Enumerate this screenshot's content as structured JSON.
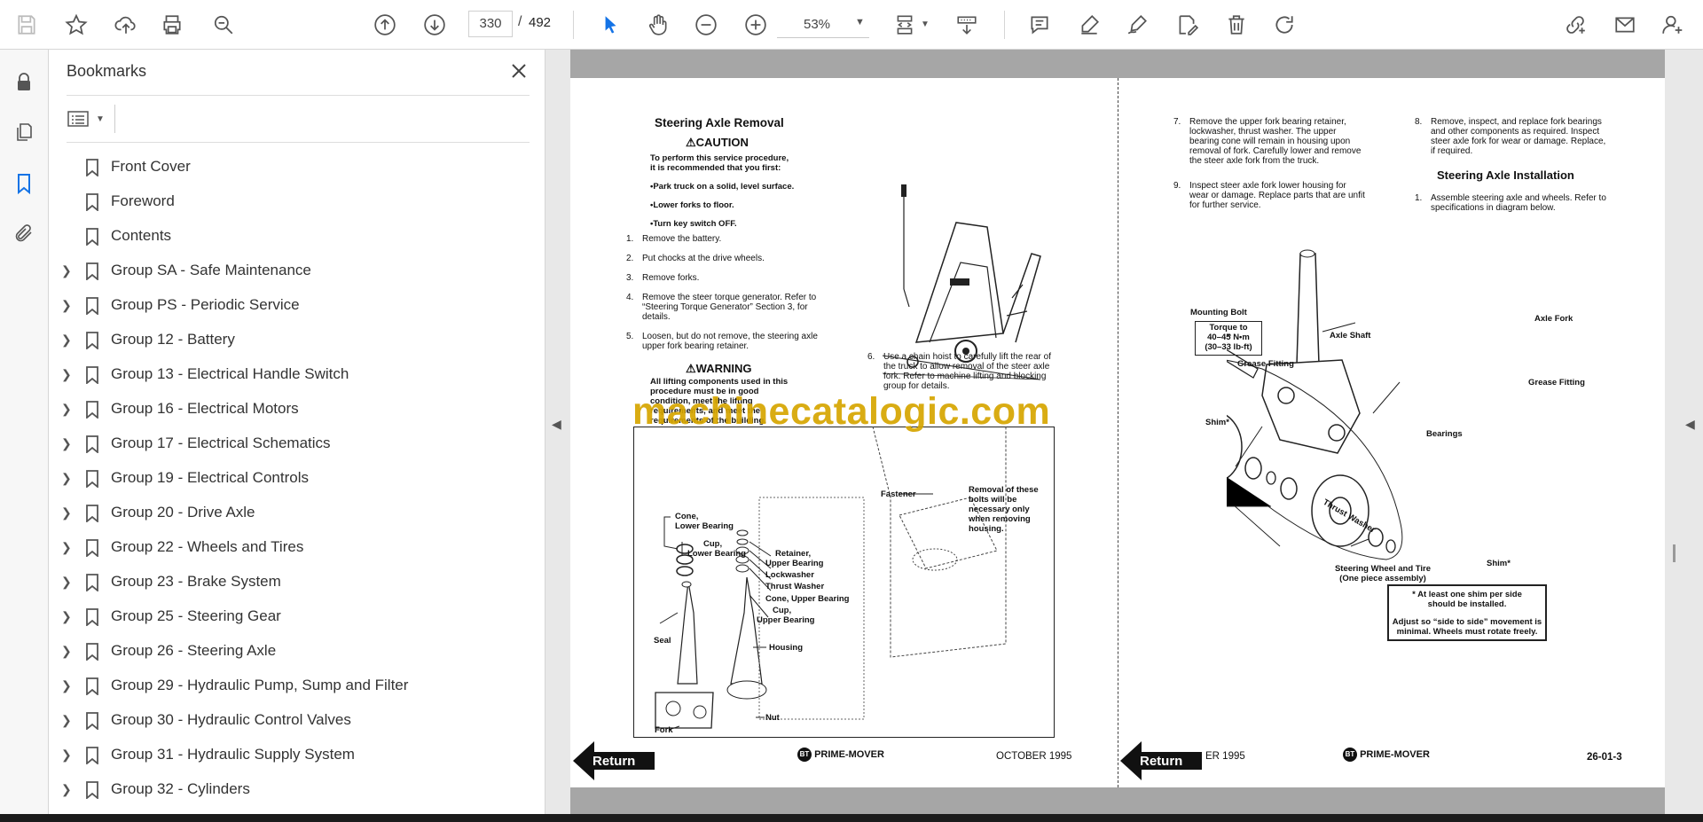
{
  "toolbar": {
    "current_page": "330",
    "page_separator": "/",
    "total_pages": "492",
    "zoom": "53%",
    "icons": [
      "save-icon",
      "bookmark-star-icon",
      "upload-icon",
      "print-icon",
      "zoom-search-icon",
      "prev-page-icon",
      "next-page-icon",
      "select-cursor-icon",
      "hand-icon",
      "zoom-out-icon",
      "zoom-in-icon",
      "fit-page-icon",
      "scroll-mode-icon",
      "comment-icon",
      "highlight-icon",
      "sign-icon",
      "edit-pdf-icon",
      "delete-icon",
      "rotate-icon",
      "share-link-icon",
      "email-icon",
      "add-user-icon"
    ]
  },
  "bookmarks_panel": {
    "title": "Bookmarks",
    "items": [
      {
        "label": "Front Cover",
        "expandable": false
      },
      {
        "label": "Foreword",
        "expandable": false
      },
      {
        "label": "Contents",
        "expandable": false
      },
      {
        "label": "Group SA - Safe Maintenance",
        "expandable": true
      },
      {
        "label": "Group PS - Periodic Service",
        "expandable": true
      },
      {
        "label": "Group 12 - Battery",
        "expandable": true
      },
      {
        "label": "Group 13 - Electrical Handle Switch",
        "expandable": true
      },
      {
        "label": "Group 16 - Electrical Motors",
        "expandable": true
      },
      {
        "label": "Group 17 - Electrical Schematics",
        "expandable": true
      },
      {
        "label": "Group 19 - Electrical Controls",
        "expandable": true
      },
      {
        "label": "Group 20 - Drive Axle",
        "expandable": true
      },
      {
        "label": "Group 22 - Wheels and Tires",
        "expandable": true
      },
      {
        "label": "Group 23 - Brake System",
        "expandable": true
      },
      {
        "label": "Group 25 - Steering Gear",
        "expandable": true
      },
      {
        "label": "Group 26 - Steering Axle",
        "expandable": true
      },
      {
        "label": "Group 29 - Hydraulic Pump, Sump and Filter",
        "expandable": true
      },
      {
        "label": "Group 30 - Hydraulic Control Valves",
        "expandable": true
      },
      {
        "label": "Group 31 - Hydraulic Supply System",
        "expandable": true
      },
      {
        "label": "Group 32 - Cylinders",
        "expandable": true
      }
    ]
  },
  "document": {
    "left_page": {
      "heading": "Steering Axle Removal",
      "caution_title": "CAUTION",
      "caution_intro_1": "To perform this service procedure,",
      "caution_intro_2": "it is recommended that you first:",
      "bullets": [
        "•Park truck on a solid, level surface.",
        "•Lower forks to floor.",
        "•Turn key switch OFF."
      ],
      "steps": [
        {
          "num": "1.",
          "lines": [
            "Remove the battery."
          ]
        },
        {
          "num": "2.",
          "lines": [
            "Put chocks at the drive wheels."
          ]
        },
        {
          "num": "3.",
          "lines": [
            "Remove forks."
          ]
        },
        {
          "num": "4.",
          "lines": [
            "Remove the steer torque generator. Refer to",
            "“Steering Torque Generator” Section 3, for",
            "details."
          ]
        },
        {
          "num": "5.",
          "lines": [
            "Loosen, but do not remove, the steering axle",
            "upper fork bearing retainer."
          ]
        }
      ],
      "step6_num": "6.",
      "step6_lines": [
        "Use a chain hoist to carefully lift the rear of",
        "the truck to allow removal of the steer axle",
        "fork. Refer to machine lifting and blocking",
        "group for details."
      ],
      "warning_title": "WARNING",
      "warning_lines": [
        "All lifting components used in this",
        "procedure must be in good",
        "condition, meet the lifting",
        "requirements, and meet the",
        "requirements of the building."
      ],
      "diagram_labels": {
        "cone_lower": [
          "Cone,",
          "Lower Bearing"
        ],
        "cup_lower": [
          "Cup,",
          "Lower Bearing"
        ],
        "retainer": [
          "Retainer,",
          "Upper Bearing"
        ],
        "lockwasher": "Lockwasher",
        "thrust_washer": "Thrust Washer",
        "cone_upper": "Cone, Upper Bearing",
        "cup_upper": [
          "Cup,",
          "Upper Bearing"
        ],
        "seal": "Seal",
        "housing": "Housing",
        "fork": "Fork",
        "nut": "Nut",
        "fastener": "Fastener",
        "fastener_note": [
          "Removal of these",
          "bolts will be",
          "necessary only",
          "when removing",
          "housing."
        ]
      },
      "footer_brand": "PRIME-MOVER",
      "footer_date": "OCTOBER 1995",
      "return_label": "Return"
    },
    "right_page": {
      "step7_num": "7.",
      "step7_lines": [
        "Remove the upper fork bearing retainer,",
        "lockwasher, thrust washer. The upper",
        "bearing cone will remain in housing upon",
        "removal of fork. Carefully lower and remove",
        "the steer axle fork from the truck."
      ],
      "step8_num": "8.",
      "step8_lines": [
        "Remove, inspect, and replace fork bearings",
        "and other components as required. Inspect",
        "steer axle fork for wear or damage. Replace,",
        "if required."
      ],
      "step9_num": "9.",
      "step9_lines": [
        "Inspect steer axle fork lower housing for",
        "wear or damage. Replace parts that are unfit",
        "for further service."
      ],
      "install_heading": "Steering Axle Installation",
      "install_step_num": "1.",
      "install_step_lines": [
        "Assemble steering axle and wheels. Refer to",
        "specifications in diagram below."
      ],
      "diagram_labels": {
        "mounting_bolt": "Mounting Bolt",
        "torque": [
          "Torque to",
          "40–45 N•m",
          "(30–33 lb-ft)"
        ],
        "axle_shaft": "Axle Shaft",
        "axle_fork": "Axle Fork",
        "grease_fitting_left": "Grease Fitting",
        "grease_fitting_right": "Grease Fitting",
        "shim_left": "Shim*",
        "bearings": "Bearings",
        "thrust_washer": "Thrust Washer",
        "shim_right": "Shim*",
        "wheel_tire": [
          "Steering Wheel and Tire",
          "(One piece assembly)"
        ],
        "note": [
          "* At least one shim per side",
          "should be installed.",
          "Adjust so “side to side” movement is",
          "minimal. Wheels must rotate freely."
        ]
      },
      "footer_date_partial": "ER 1995",
      "footer_brand": "PRIME-MOVER",
      "footer_page": "26-01-3",
      "return_label": "Return"
    },
    "watermark": "machinecatalogic.com"
  }
}
